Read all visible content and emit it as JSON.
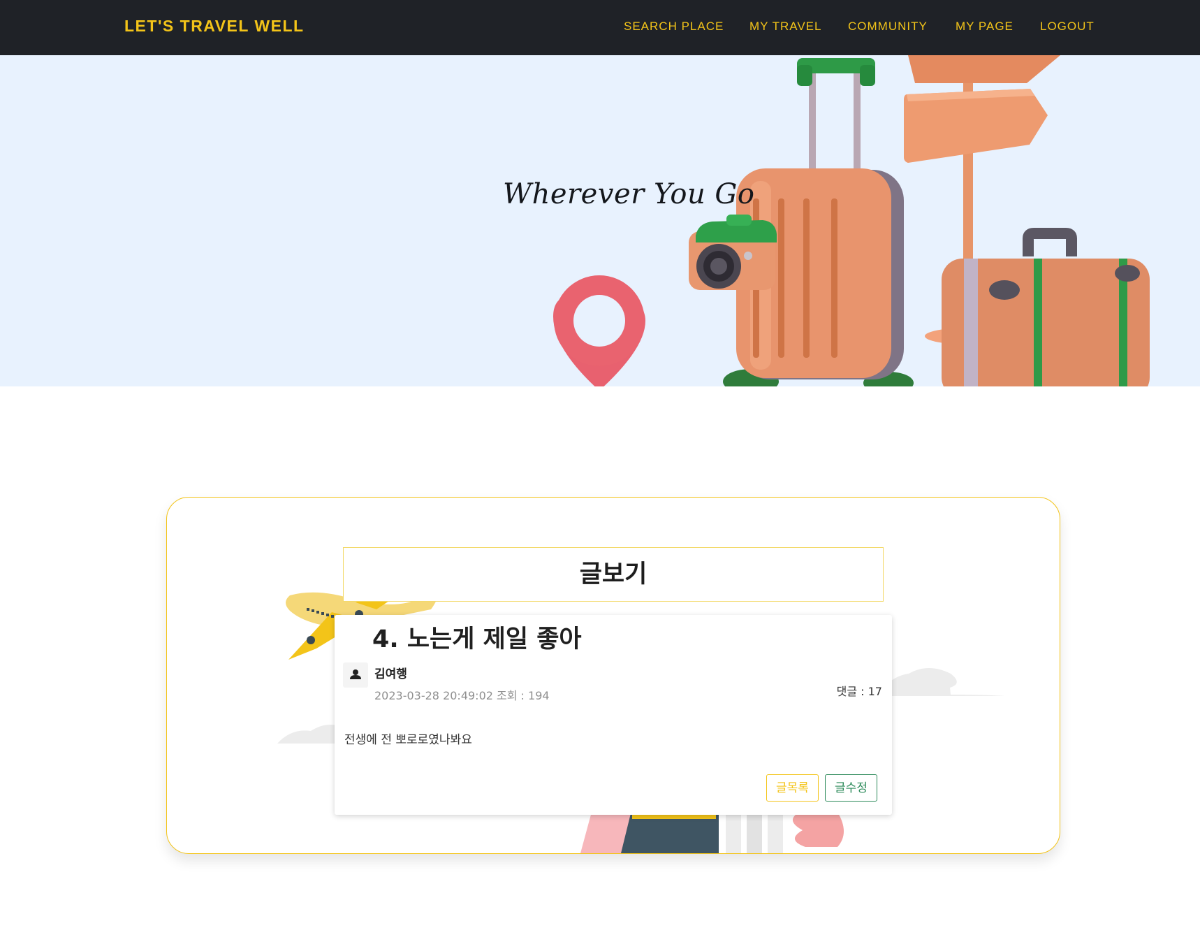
{
  "navbar": {
    "brand": "LET'S TRAVEL WELL",
    "links": [
      "SEARCH PLACE",
      "MY TRAVEL",
      "COMMUNITY",
      "MY PAGE",
      "LOGOUT"
    ],
    "background_color": "#1f2227",
    "accent_color": "#f3c419"
  },
  "hero": {
    "title": "Wherever You Go",
    "background_color": "#e8f2fe",
    "illustration": [
      "suitcase-illustration",
      "camera-illustration",
      "location-pin-illustration",
      "signpost-illustration"
    ]
  },
  "board": {
    "header": "글보기",
    "decorations": [
      "airplane-illustration",
      "cloud-illustration",
      "traveler-illustration"
    ]
  },
  "post": {
    "title": "4. 노는게 제일 좋아",
    "author": "김여행",
    "avatar_icon": "user-icon",
    "meta": "2023-03-28 20:49:02 조회 : 194",
    "comments": "댓글 : 17",
    "content": "전생에 전 뽀로로였나봐요",
    "list_button": "글목록",
    "edit_button": "글수정"
  }
}
